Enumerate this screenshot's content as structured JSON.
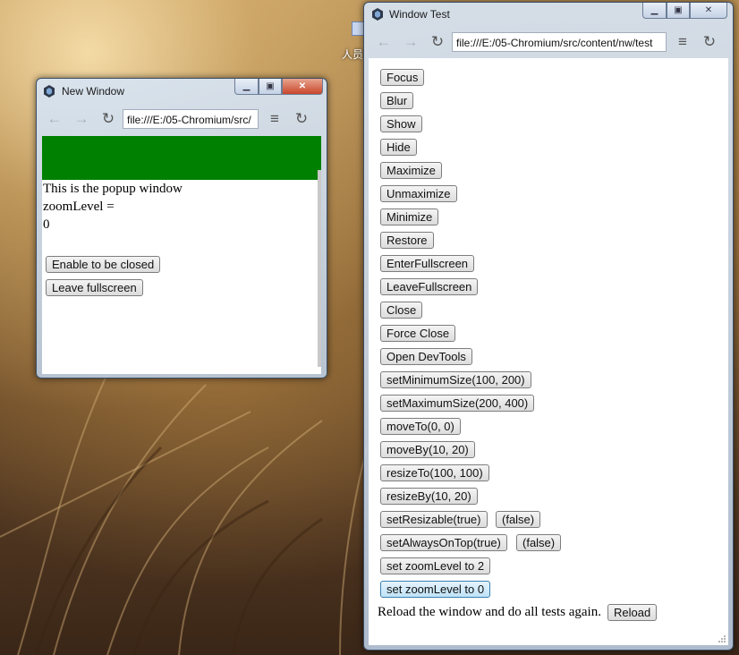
{
  "desktop": {
    "label_fragment": "人员"
  },
  "popup": {
    "title": "New Window",
    "url": "file:///E:/05-Chromium/src/",
    "lines": [
      "This is the popup window",
      "zoomLevel =",
      "0"
    ],
    "buttons": {
      "enable_close": "Enable to be closed",
      "leave_fullscreen": "Leave fullscreen"
    }
  },
  "main": {
    "title": "Window Test",
    "url": "file:///E:/05-Chromium/src/content/nw/test",
    "buttons": {
      "focus": "Focus",
      "blur": "Blur",
      "show": "Show",
      "hide": "Hide",
      "maximize": "Maximize",
      "unmaximize": "Unmaximize",
      "minimize": "Minimize",
      "restore": "Restore",
      "enter_fullscreen": "EnterFullscreen",
      "leave_fullscreen": "LeaveFullscreen",
      "close": "Close",
      "force_close": "Force Close",
      "open_devtools": "Open DevTools",
      "set_min_size": "setMinimumSize(100, 200)",
      "set_max_size": "setMaximumSize(200, 400)",
      "move_to": "moveTo(0, 0)",
      "move_by": "moveBy(10, 20)",
      "resize_to": "resizeTo(100, 100)",
      "resize_by": "resizeBy(10, 20)",
      "set_resizable_true": "setResizable(true)",
      "set_resizable_false": "(false)",
      "set_always_on_top_true": "setAlwaysOnTop(true)",
      "set_always_on_top_false": "(false)",
      "set_zoom_2": "set zoomLevel to 2",
      "set_zoom_0": "set zoomLevel to 0",
      "reload": "Reload"
    },
    "reload_text": "Reload the window and do all tests again."
  }
}
